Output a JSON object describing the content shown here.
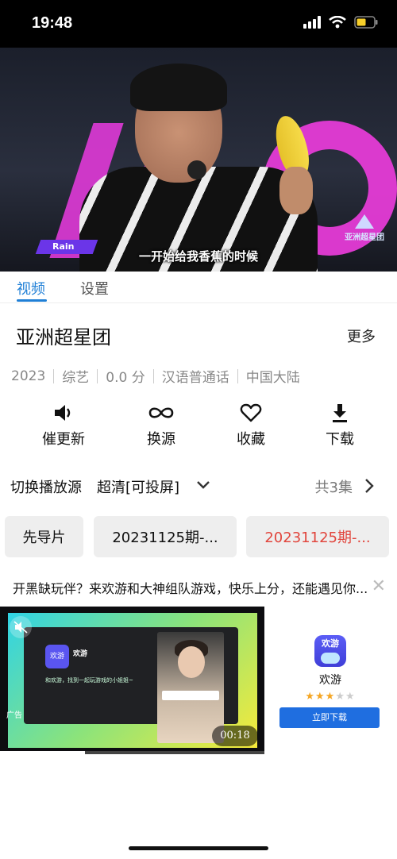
{
  "status_bar": {
    "time": "19:48"
  },
  "video": {
    "name_tag": "Rain",
    "subtitle": "一开始给我香蕉的时候",
    "show_logo": "亚洲超星团"
  },
  "tabs": [
    {
      "label": "视频",
      "active": true
    },
    {
      "label": "设置",
      "active": false
    }
  ],
  "show": {
    "title": "亚洲超星团",
    "more_label": "更多",
    "meta": [
      "2023",
      "综艺",
      "0.0 分",
      "汉语普通话",
      "中国大陆"
    ]
  },
  "actions": [
    {
      "label": "催更新",
      "icon": "speaker-icon"
    },
    {
      "label": "换源",
      "icon": "infinity-icon"
    },
    {
      "label": "收藏",
      "icon": "heart-icon"
    },
    {
      "label": "下载",
      "icon": "download-icon"
    }
  ],
  "source": {
    "label": "切换播放源",
    "quality": "超清[可投屏]",
    "episode_count": "共3集"
  },
  "episodes": [
    {
      "label": "先导片",
      "selected": false
    },
    {
      "label": "20231125期-...",
      "selected": false
    },
    {
      "label": "20231125期-...",
      "selected": true
    }
  ],
  "ad": {
    "text": "开黑缺玩伴？来欢游和大神组队游戏，快乐上分，还能遇见你...",
    "media_app_label": "欢游",
    "media_title": "欢游",
    "media_desc": "和欢游，找到一起玩游戏的小姐姐~",
    "ad_tag": "广告",
    "timer": "00:18",
    "progress": 0.32,
    "app_name": "欢游",
    "app_icon_text": "欢游",
    "rating": 3,
    "rating_max": 5,
    "download_label": "立即下载"
  },
  "colors": {
    "accent": "#1f7fd6",
    "selected_episode": "#e1453c",
    "download_button": "#1f6ee0"
  }
}
